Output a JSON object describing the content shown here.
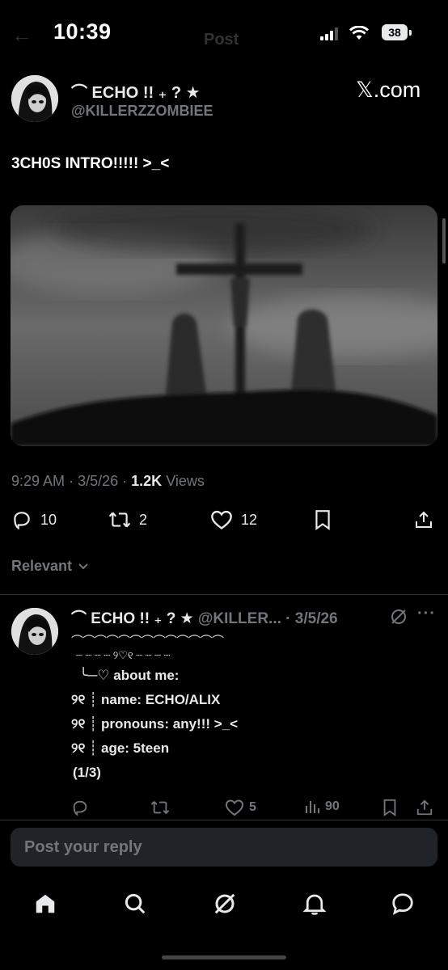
{
  "status_bar": {
    "time": "10:39",
    "battery": "38",
    "title": "Post"
  },
  "post": {
    "display_name": "⌒ ECHO !! ₊ ? ★",
    "handle": "@KILLERZZOMBIEE",
    "watermark": "𝕏.com",
    "text": "3CH0S INTRO!!!!! >_<",
    "time": "9:29 AM",
    "date": "3/5/26",
    "views_count": "1.2K",
    "views_label": "Views",
    "replies": "10",
    "reposts": "2",
    "likes": "12"
  },
  "sort": {
    "label": "Relevant"
  },
  "reply": {
    "display_name": "⌒ ECHO !! ₊ ? ★",
    "handle": "@KILLER...",
    "date": "· 3/5/26",
    "lines": [
      "⌒⌒⌒⌒⌒⌒⌒⌒⌒⌒⌒⌒⌒",
      "┈ ┈ ┈ ┈ ୨♡୧ ┈ ┈ ┈ ┈",
      "╰─♡ about me:",
      "୨୧ ┊ name:  ECHO/ALIX",
      "୨୧ ┊ pronouns: any!!! >_<",
      "୨୧ ┊ age: 5teen",
      "(1/3)"
    ],
    "likes": "5",
    "views": "90"
  },
  "composer": {
    "placeholder": "Post your reply"
  },
  "colors": {
    "background": "#000000",
    "text": "#e7e9ea",
    "muted": "#71767b",
    "divider": "#2f3336",
    "composer_bg": "#202327"
  },
  "icons": [
    "back-arrow-icon",
    "signal-icon",
    "wifi-icon",
    "battery-icon",
    "reply-icon",
    "repost-icon",
    "like-icon",
    "bookmark-icon",
    "share-icon",
    "grok-icon",
    "more-icon",
    "views-icon",
    "home-icon",
    "search-icon",
    "notifications-icon",
    "messages-icon",
    "chevron-down-icon"
  ]
}
